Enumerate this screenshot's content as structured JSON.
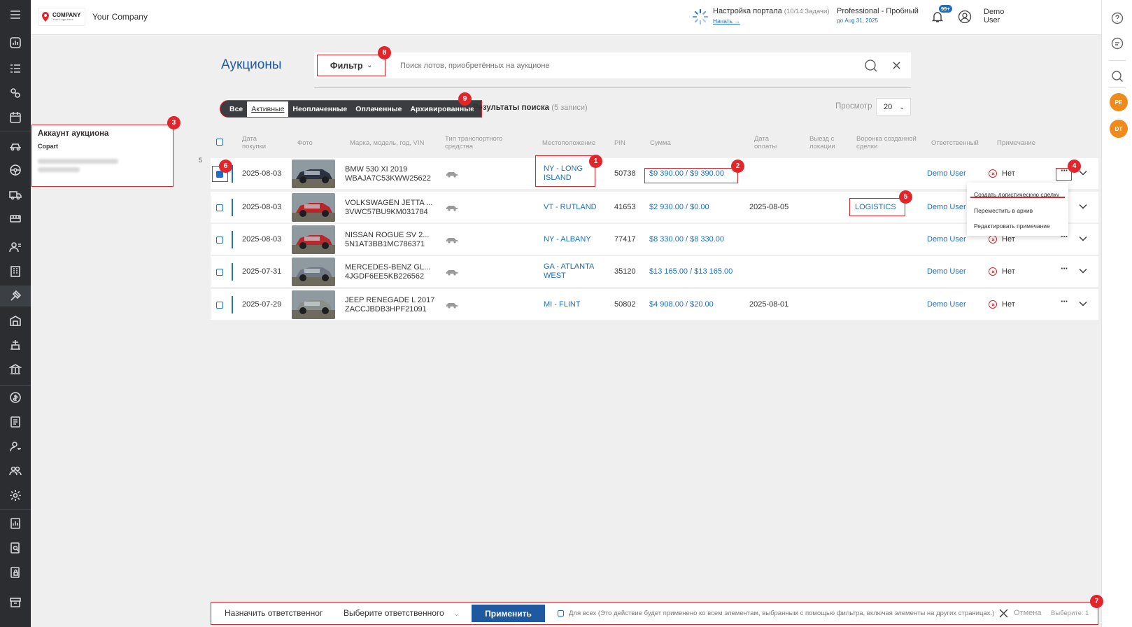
{
  "header": {
    "logo_text": "COMPANY",
    "logo_sub": "Your Logo Here",
    "company_name": "Your Company",
    "portal_setup_title": "Настройка портала",
    "portal_setup_tasks": "(10/14 Задачи)",
    "portal_setup_start": "Начать →",
    "plan_title": "Professional - Пробный",
    "plan_sub": "до Aug 31, 2025",
    "notifications_badge": "99+",
    "user_first": "Demo",
    "user_last": "User"
  },
  "right_bar": {
    "avatars": [
      "PE",
      "DT"
    ]
  },
  "account_panel": {
    "title": "Аккаунт аукциона",
    "subtitle": "Copart"
  },
  "row_count_label": "5",
  "page": {
    "title": "Аукционы",
    "filter_label": "Фильтр",
    "search_placeholder": "Поиск лотов, приобретённых на аукционе"
  },
  "tabs": [
    {
      "label": "Все",
      "active": false
    },
    {
      "label": "Активные",
      "active": true
    },
    {
      "label": "Неоплаченные",
      "active": false
    },
    {
      "label": "Оплаченные",
      "active": false
    },
    {
      "label": "Архивированные",
      "active": false
    }
  ],
  "results": {
    "label": "Результаты поиска",
    "count": "(5 записи)",
    "view_label": "Просмотр",
    "view_value": "20"
  },
  "table": {
    "columns": [
      "Дата покупки",
      "Фото",
      "Марка, модель, год, VIN",
      "Тип транспортного средства",
      "Местоположение",
      "PIN",
      "Сумма",
      "Дата оплаты",
      "Выезд с локации",
      "Воронка созданной сделки",
      "Ответственный",
      "Примечание"
    ],
    "rows": [
      {
        "date": "2025-08-03",
        "model": "BMW 530 XI 2019",
        "vin": "WBAJA7C53KWW25622",
        "location": "NY - LONG ISLAND",
        "pin": "50738",
        "amount": "$9 390.00 / $9 390.00",
        "paid_date": "",
        "funnel": "",
        "responsible": "Demo User",
        "note": "Нет",
        "checked": true,
        "photo_color": "#2a3140"
      },
      {
        "date": "2025-08-03",
        "model": "VOLKSWAGEN JETTA ...",
        "vin": "3VWC57BU9KM031784",
        "location": "VT - RUTLAND",
        "pin": "41653",
        "amount": "$2 930.00 / $0.00",
        "paid_date": "2025-08-05",
        "funnel": "LOGISTICS",
        "responsible": "Demo User",
        "note": "",
        "checked": false,
        "photo_color": "#b8262b"
      },
      {
        "date": "2025-08-03",
        "model": "NISSAN ROGUE SV 2...",
        "vin": "5N1AT3BB1MC786371",
        "location": "NY - ALBANY",
        "pin": "77417",
        "amount": "$8 330.00 / $8 330.00",
        "paid_date": "",
        "funnel": "",
        "responsible": "Demo User",
        "note": "Нет",
        "checked": false,
        "photo_color": "#b52a2e"
      },
      {
        "date": "2025-07-31",
        "model": "MERCEDES-BENZ GL...",
        "vin": "4JGDF6EE5KB226562",
        "location": "GA - ATLANTA WEST",
        "pin": "35120",
        "amount": "$13 165.00 / $13 165.00",
        "paid_date": "",
        "funnel": "",
        "responsible": "Demo User",
        "note": "Нет",
        "checked": false,
        "photo_color": "#6f7884"
      },
      {
        "date": "2025-07-29",
        "model": "JEEP RENEGADE L 2017",
        "vin": "ZACCJBDB3HPF21091",
        "location": "MI - FLINT",
        "pin": "50802",
        "amount": "$4 908.00 / $20.00",
        "paid_date": "2025-08-01",
        "funnel": "",
        "responsible": "Demo User",
        "note": "Нет",
        "checked": false,
        "photo_color": "#8a9089"
      }
    ]
  },
  "context_menu": {
    "items": [
      "Создать логистическую сделку",
      "Переместить в архив",
      "Редактировать примечание"
    ]
  },
  "bottom_bar": {
    "assign_label": "Назначить ответственного",
    "select_placeholder": "Выберите ответственного",
    "apply_label": "Применить",
    "for_all_text": "Для всех (Это действие будет применено ко всем элементам, выбранным с помощью фильтра, включая элементы на других страницах.)",
    "cancel_label": "Отмена",
    "selected_text": "Выберите: 1"
  },
  "annotations": [
    "1",
    "2",
    "3",
    "4",
    "5",
    "6",
    "7",
    "8",
    "9"
  ],
  "colors": {
    "accent": "#1c6fc4",
    "annotation": "#e0262b",
    "sidebar": "#2b2d30",
    "avatar": "#f08a1c"
  }
}
